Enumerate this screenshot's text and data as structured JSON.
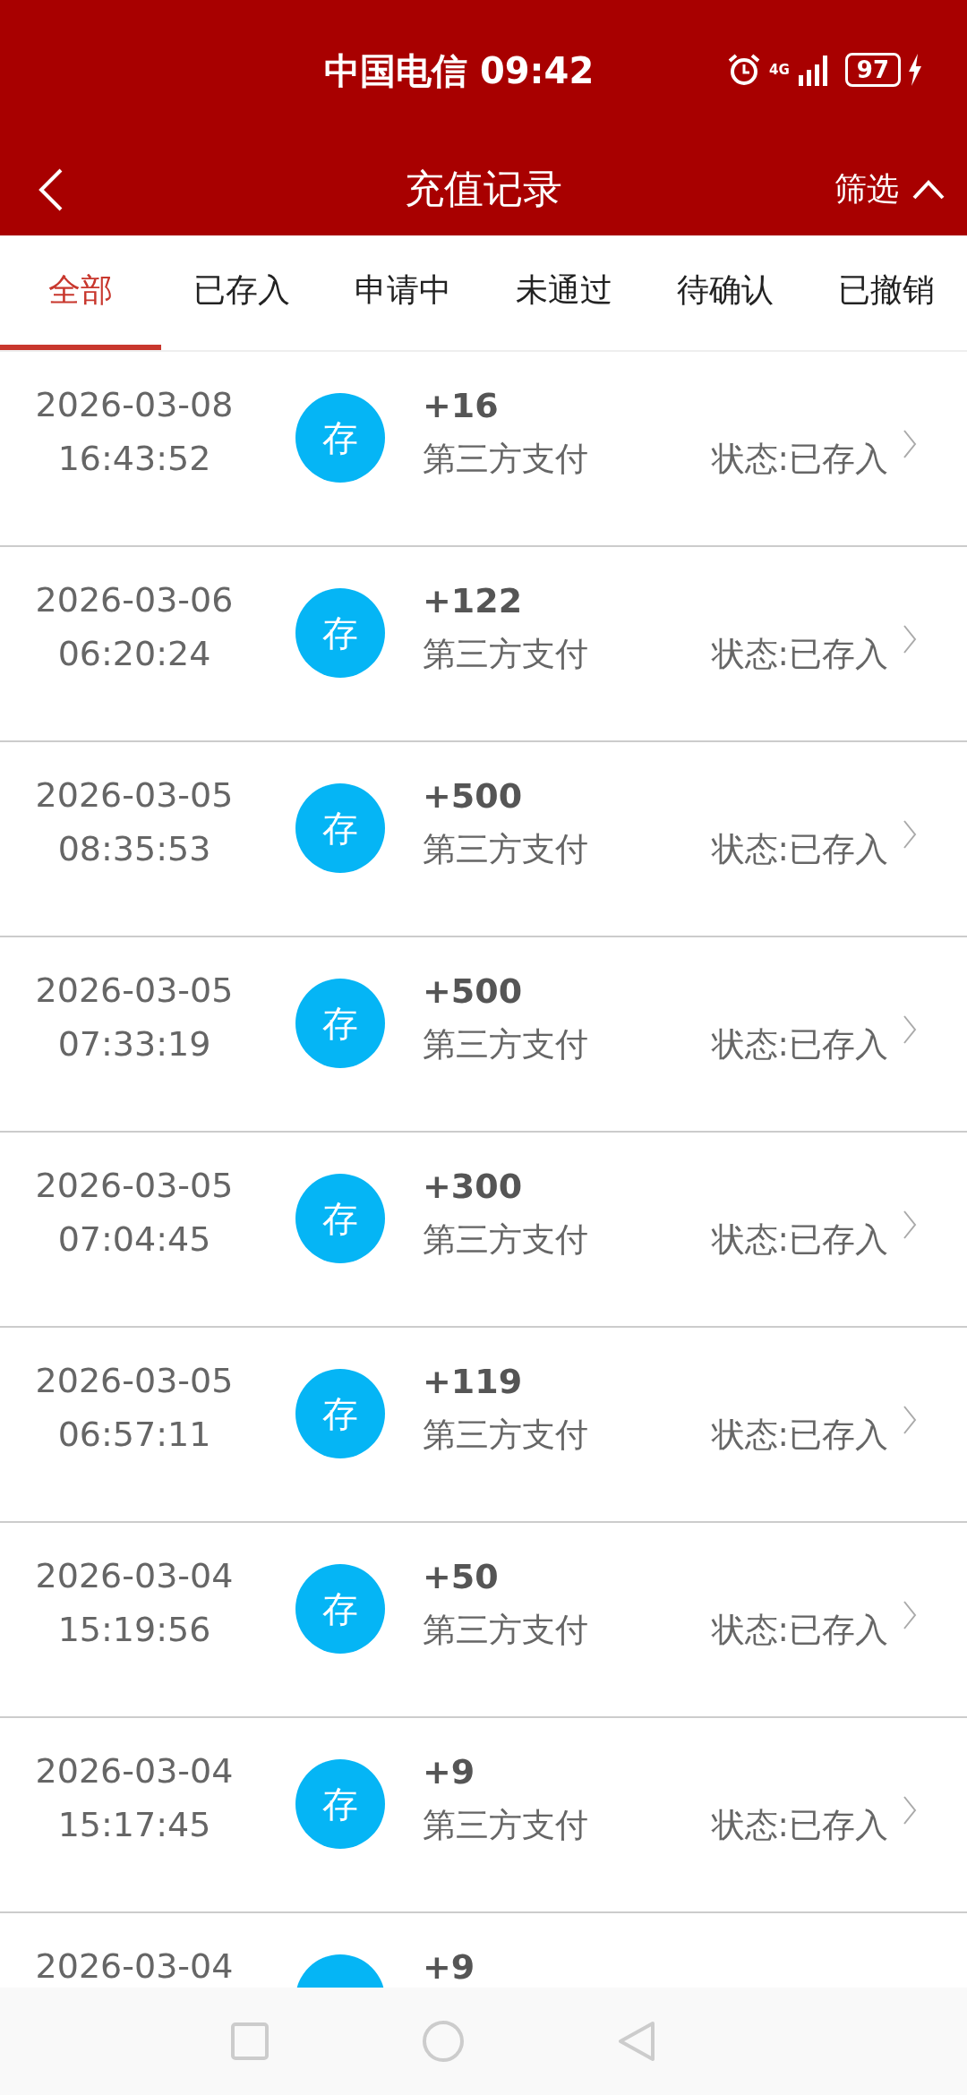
{
  "status_bar": {
    "carrier": "中国电信",
    "time": "09:42",
    "network": "4G",
    "battery": "97"
  },
  "header": {
    "title": "充值记录",
    "filter": "筛选"
  },
  "tabs": [
    {
      "label": "全部",
      "selected": true
    },
    {
      "label": "已存入",
      "selected": false
    },
    {
      "label": "申请中",
      "selected": false
    },
    {
      "label": "未通过",
      "selected": false
    },
    {
      "label": "待确认",
      "selected": false
    },
    {
      "label": "已撤销",
      "selected": false
    }
  ],
  "records": [
    {
      "date": "2026-03-08",
      "time": "16:43:52",
      "badge": "存",
      "amount": "+16",
      "method": "第三方支付",
      "status": "状态:已存入"
    },
    {
      "date": "2026-03-06",
      "time": "06:20:24",
      "badge": "存",
      "amount": "+122",
      "method": "第三方支付",
      "status": "状态:已存入"
    },
    {
      "date": "2026-03-05",
      "time": "08:35:53",
      "badge": "存",
      "amount": "+500",
      "method": "第三方支付",
      "status": "状态:已存入"
    },
    {
      "date": "2026-03-05",
      "time": "07:33:19",
      "badge": "存",
      "amount": "+500",
      "method": "第三方支付",
      "status": "状态:已存入"
    },
    {
      "date": "2026-03-05",
      "time": "07:04:45",
      "badge": "存",
      "amount": "+300",
      "method": "第三方支付",
      "status": "状态:已存入"
    },
    {
      "date": "2026-03-05",
      "time": "06:57:11",
      "badge": "存",
      "amount": "+119",
      "method": "第三方支付",
      "status": "状态:已存入"
    },
    {
      "date": "2026-03-04",
      "time": "15:19:56",
      "badge": "存",
      "amount": "+50",
      "method": "第三方支付",
      "status": "状态:已存入"
    },
    {
      "date": "2026-03-04",
      "time": "15:17:45",
      "badge": "存",
      "amount": "+9",
      "method": "第三方支付",
      "status": "状态:已存入"
    },
    {
      "date": "2026-03-04",
      "amount": "+9"
    }
  ]
}
